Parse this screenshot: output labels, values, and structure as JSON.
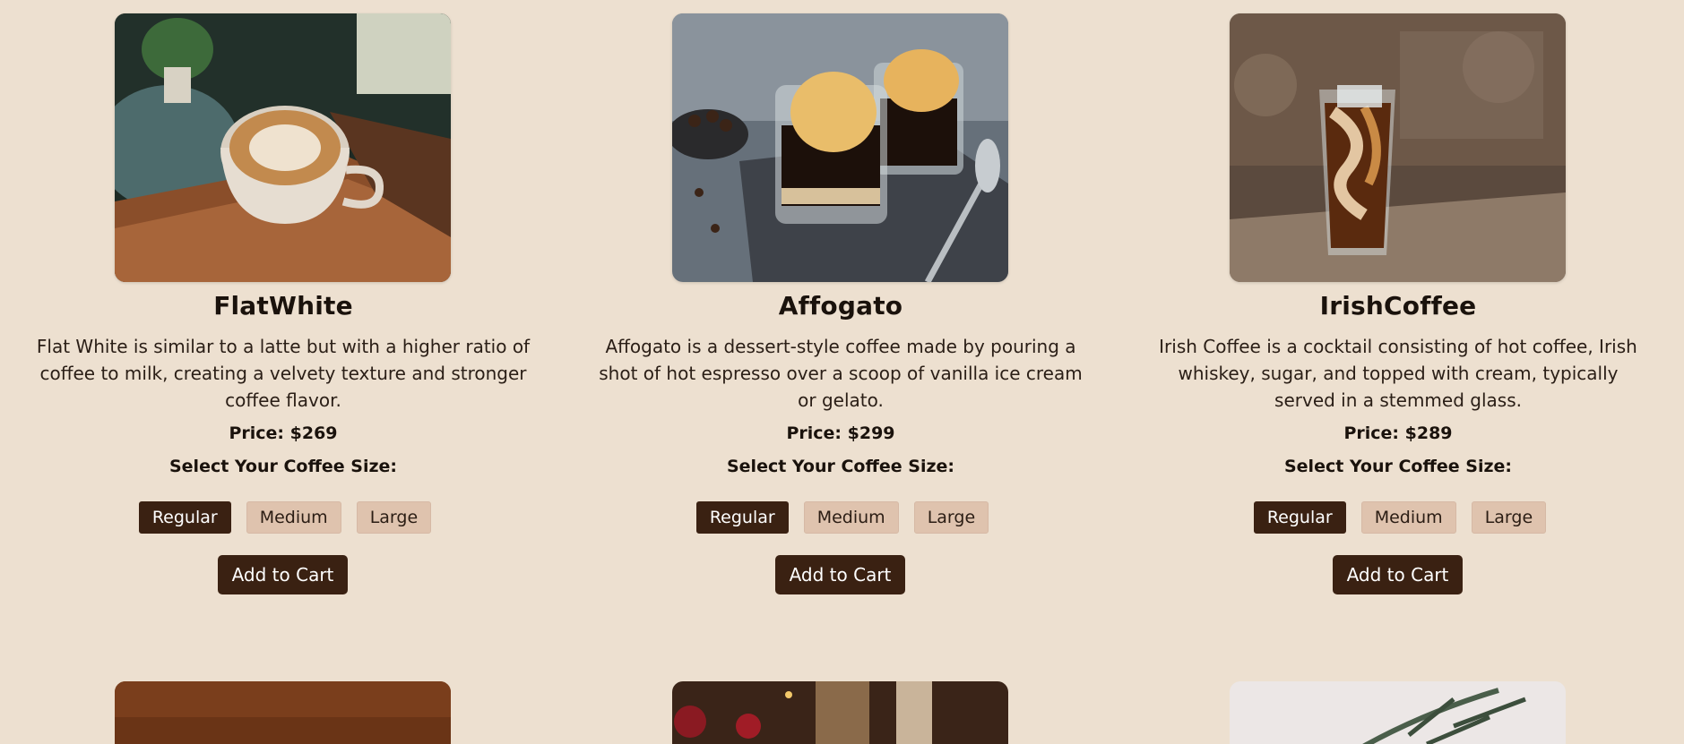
{
  "products": [
    {
      "name": "FlatWhite",
      "description": "Flat White is similar to a latte but with a higher ratio of coffee to milk, creating a velvety texture and stronger coffee flavor.",
      "price": "Price: $269",
      "size_label": "Select Your Coffee Size:",
      "sizes": [
        "Regular",
        "Medium",
        "Large"
      ],
      "selected_size": "Regular",
      "add_to_cart": "Add to Cart"
    },
    {
      "name": "Affogato",
      "description": "Affogato is a dessert-style coffee made by pouring a shot of hot espresso over a scoop of vanilla ice cream or gelato.",
      "price": "Price: $299",
      "size_label": "Select Your Coffee Size:",
      "sizes": [
        "Regular",
        "Medium",
        "Large"
      ],
      "selected_size": "Regular",
      "add_to_cart": "Add to Cart"
    },
    {
      "name": "IrishCoffee",
      "description": "Irish Coffee is a cocktail consisting of hot coffee, Irish whiskey, sugar, and topped with cream, typically served in a stemmed glass.",
      "price": "Price: $289",
      "size_label": "Select Your Coffee Size:",
      "sizes": [
        "Regular",
        "Medium",
        "Large"
      ],
      "selected_size": "Regular",
      "add_to_cart": "Add to Cart"
    }
  ],
  "colors": {
    "page_background": "#ede0d0",
    "accent_dark": "#3a2112",
    "size_button_inactive": "#dfc3ae"
  }
}
